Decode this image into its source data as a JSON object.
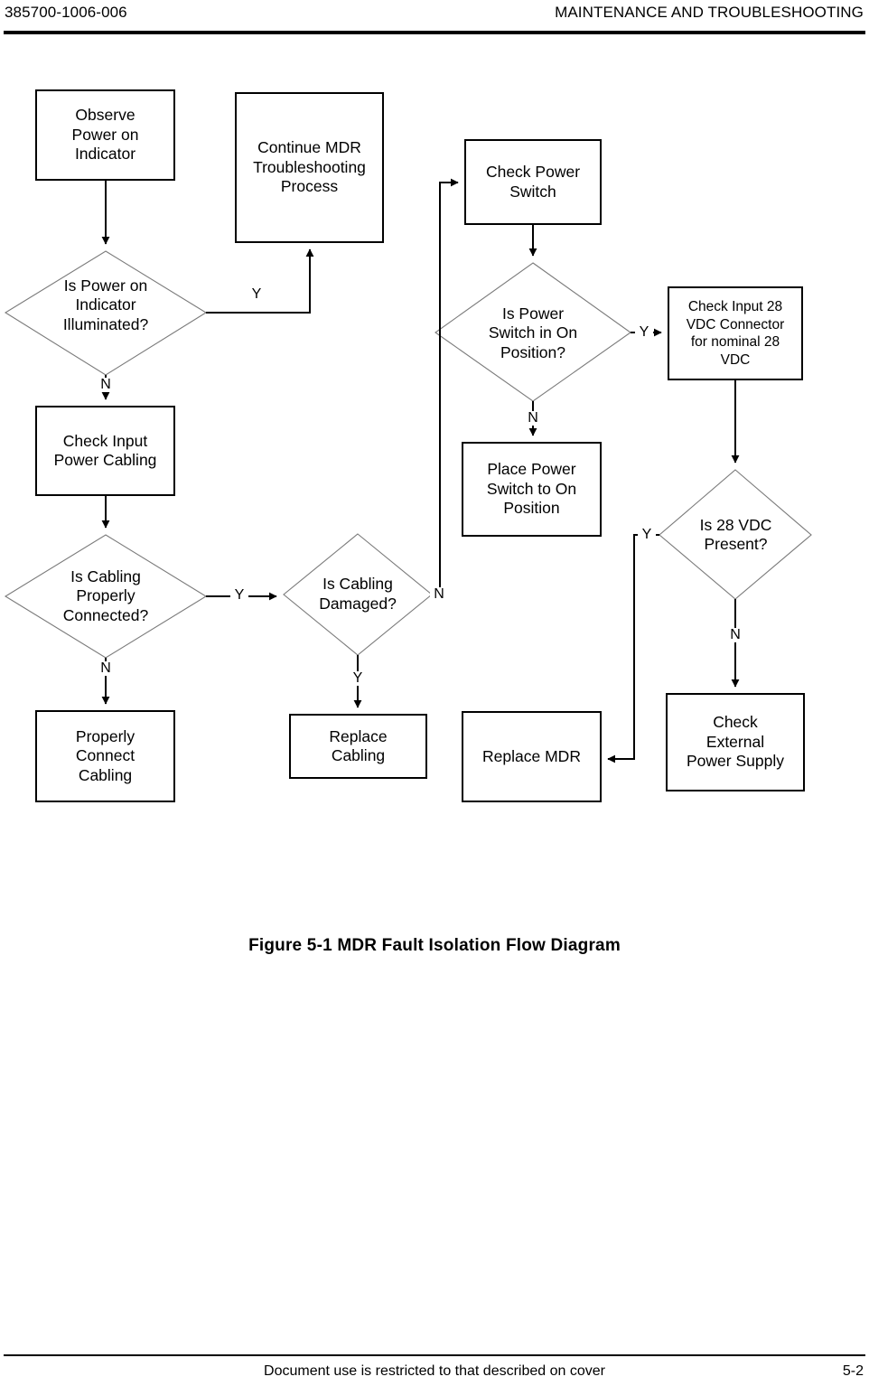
{
  "header": {
    "doc_number": "385700-1006-006",
    "section_title": "MAINTENANCE AND TROUBLESHOOTING"
  },
  "footer": {
    "restriction_notice": "Document use is restricted to that described on cover",
    "page_number": "5-2"
  },
  "figure": {
    "caption": "Figure 5-1  MDR Fault Isolation Flow Diagram"
  },
  "diagram": {
    "title": "MDR Fault Isolation Flow Diagram",
    "colors": {
      "process_stroke": "#000000",
      "decision_stroke": "#7a7a7a",
      "connector": "#000000",
      "fill": "#ffffff",
      "text": "#000000"
    },
    "nodes": [
      {
        "id": "observe_power_indicator",
        "type": "process",
        "label": "Observe\nPower on\nIndicator"
      },
      {
        "id": "continue_mdr",
        "type": "process",
        "label": "Continue MDR\nTroubleshooting\nProcess"
      },
      {
        "id": "is_power_indicator_lit",
        "type": "decision",
        "label": "Is Power on\nIndicator\nIlluminated?"
      },
      {
        "id": "check_input_power_cabling",
        "type": "process",
        "label": "Check Input\nPower Cabling"
      },
      {
        "id": "is_cabling_connected",
        "type": "decision",
        "label": "Is Cabling\nProperly\nConnected?"
      },
      {
        "id": "is_cabling_damaged",
        "type": "decision",
        "label": "Is Cabling\nDamaged?"
      },
      {
        "id": "properly_connect_cabling",
        "type": "process",
        "label": "Properly\nConnect\nCabling"
      },
      {
        "id": "replace_cabling",
        "type": "process",
        "label": "Replace\nCabling"
      },
      {
        "id": "check_power_switch",
        "type": "process",
        "label": "Check Power\nSwitch"
      },
      {
        "id": "is_power_switch_on",
        "type": "decision",
        "label": "Is Power\nSwitch in On\nPosition?"
      },
      {
        "id": "place_switch_on",
        "type": "process",
        "label": "Place Power\nSwitch to On\nPosition"
      },
      {
        "id": "check_input_28vdc",
        "type": "process",
        "label": "Check Input 28\nVDC Connector\nfor nominal 28\nVDC"
      },
      {
        "id": "is_28vdc_present",
        "type": "decision",
        "label": "Is 28 VDC\nPresent?"
      },
      {
        "id": "check_external_psu",
        "type": "process",
        "label": "Check\nExternal\nPower Supply"
      },
      {
        "id": "replace_mdr",
        "type": "process",
        "label": "Replace MDR"
      }
    ],
    "edge_labels": {
      "indicator_lit_yes": "Y",
      "indicator_lit_no": "N",
      "cabling_connected_yes": "Y",
      "cabling_connected_no": "N",
      "cabling_damaged_yes": "Y",
      "cabling_damaged_no": "N",
      "switch_on_yes": "Y",
      "switch_on_no": "N",
      "vdc_present_yes": "Y",
      "vdc_present_no": "N"
    }
  }
}
